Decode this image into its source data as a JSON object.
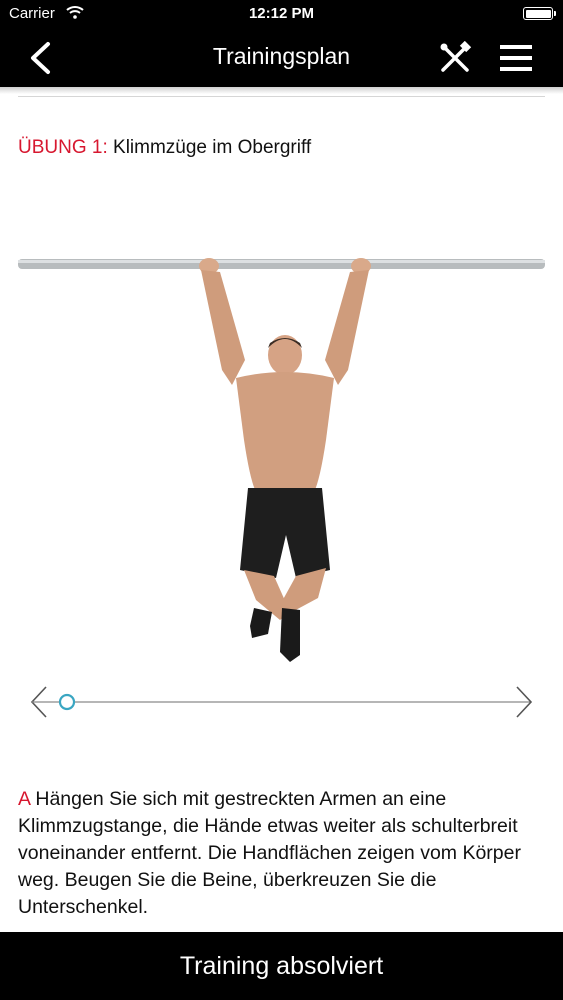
{
  "status_bar": {
    "carrier": "Carrier",
    "time": "12:12 PM"
  },
  "nav": {
    "title": "Trainingsplan"
  },
  "exercise": {
    "prefix": "ÜBUNG 1:",
    "name": "Klimmzüge im Obergriff"
  },
  "slider": {
    "position": 0
  },
  "description": {
    "marker": "A",
    "text": "Hängen Sie sich mit gestreckten Armen an eine Klimmzugstange, die Hände etwas weiter als schulter­breit voneinander entfernt. Die Handflächen zeigen vom Körper weg. Beugen Sie die Beine, überkreuzen Sie die Unterschenkel."
  },
  "footer": {
    "button_label": "Training absolviert"
  },
  "colors": {
    "accent_red": "#d7172f",
    "slider_teal": "#3aa6c2",
    "bar_black": "#000000"
  },
  "icons": [
    "back-chevron-icon",
    "wifi-icon",
    "battery-icon",
    "tools-icon",
    "menu-icon",
    "slider-left-arrow-icon",
    "slider-right-arrow-icon"
  ]
}
